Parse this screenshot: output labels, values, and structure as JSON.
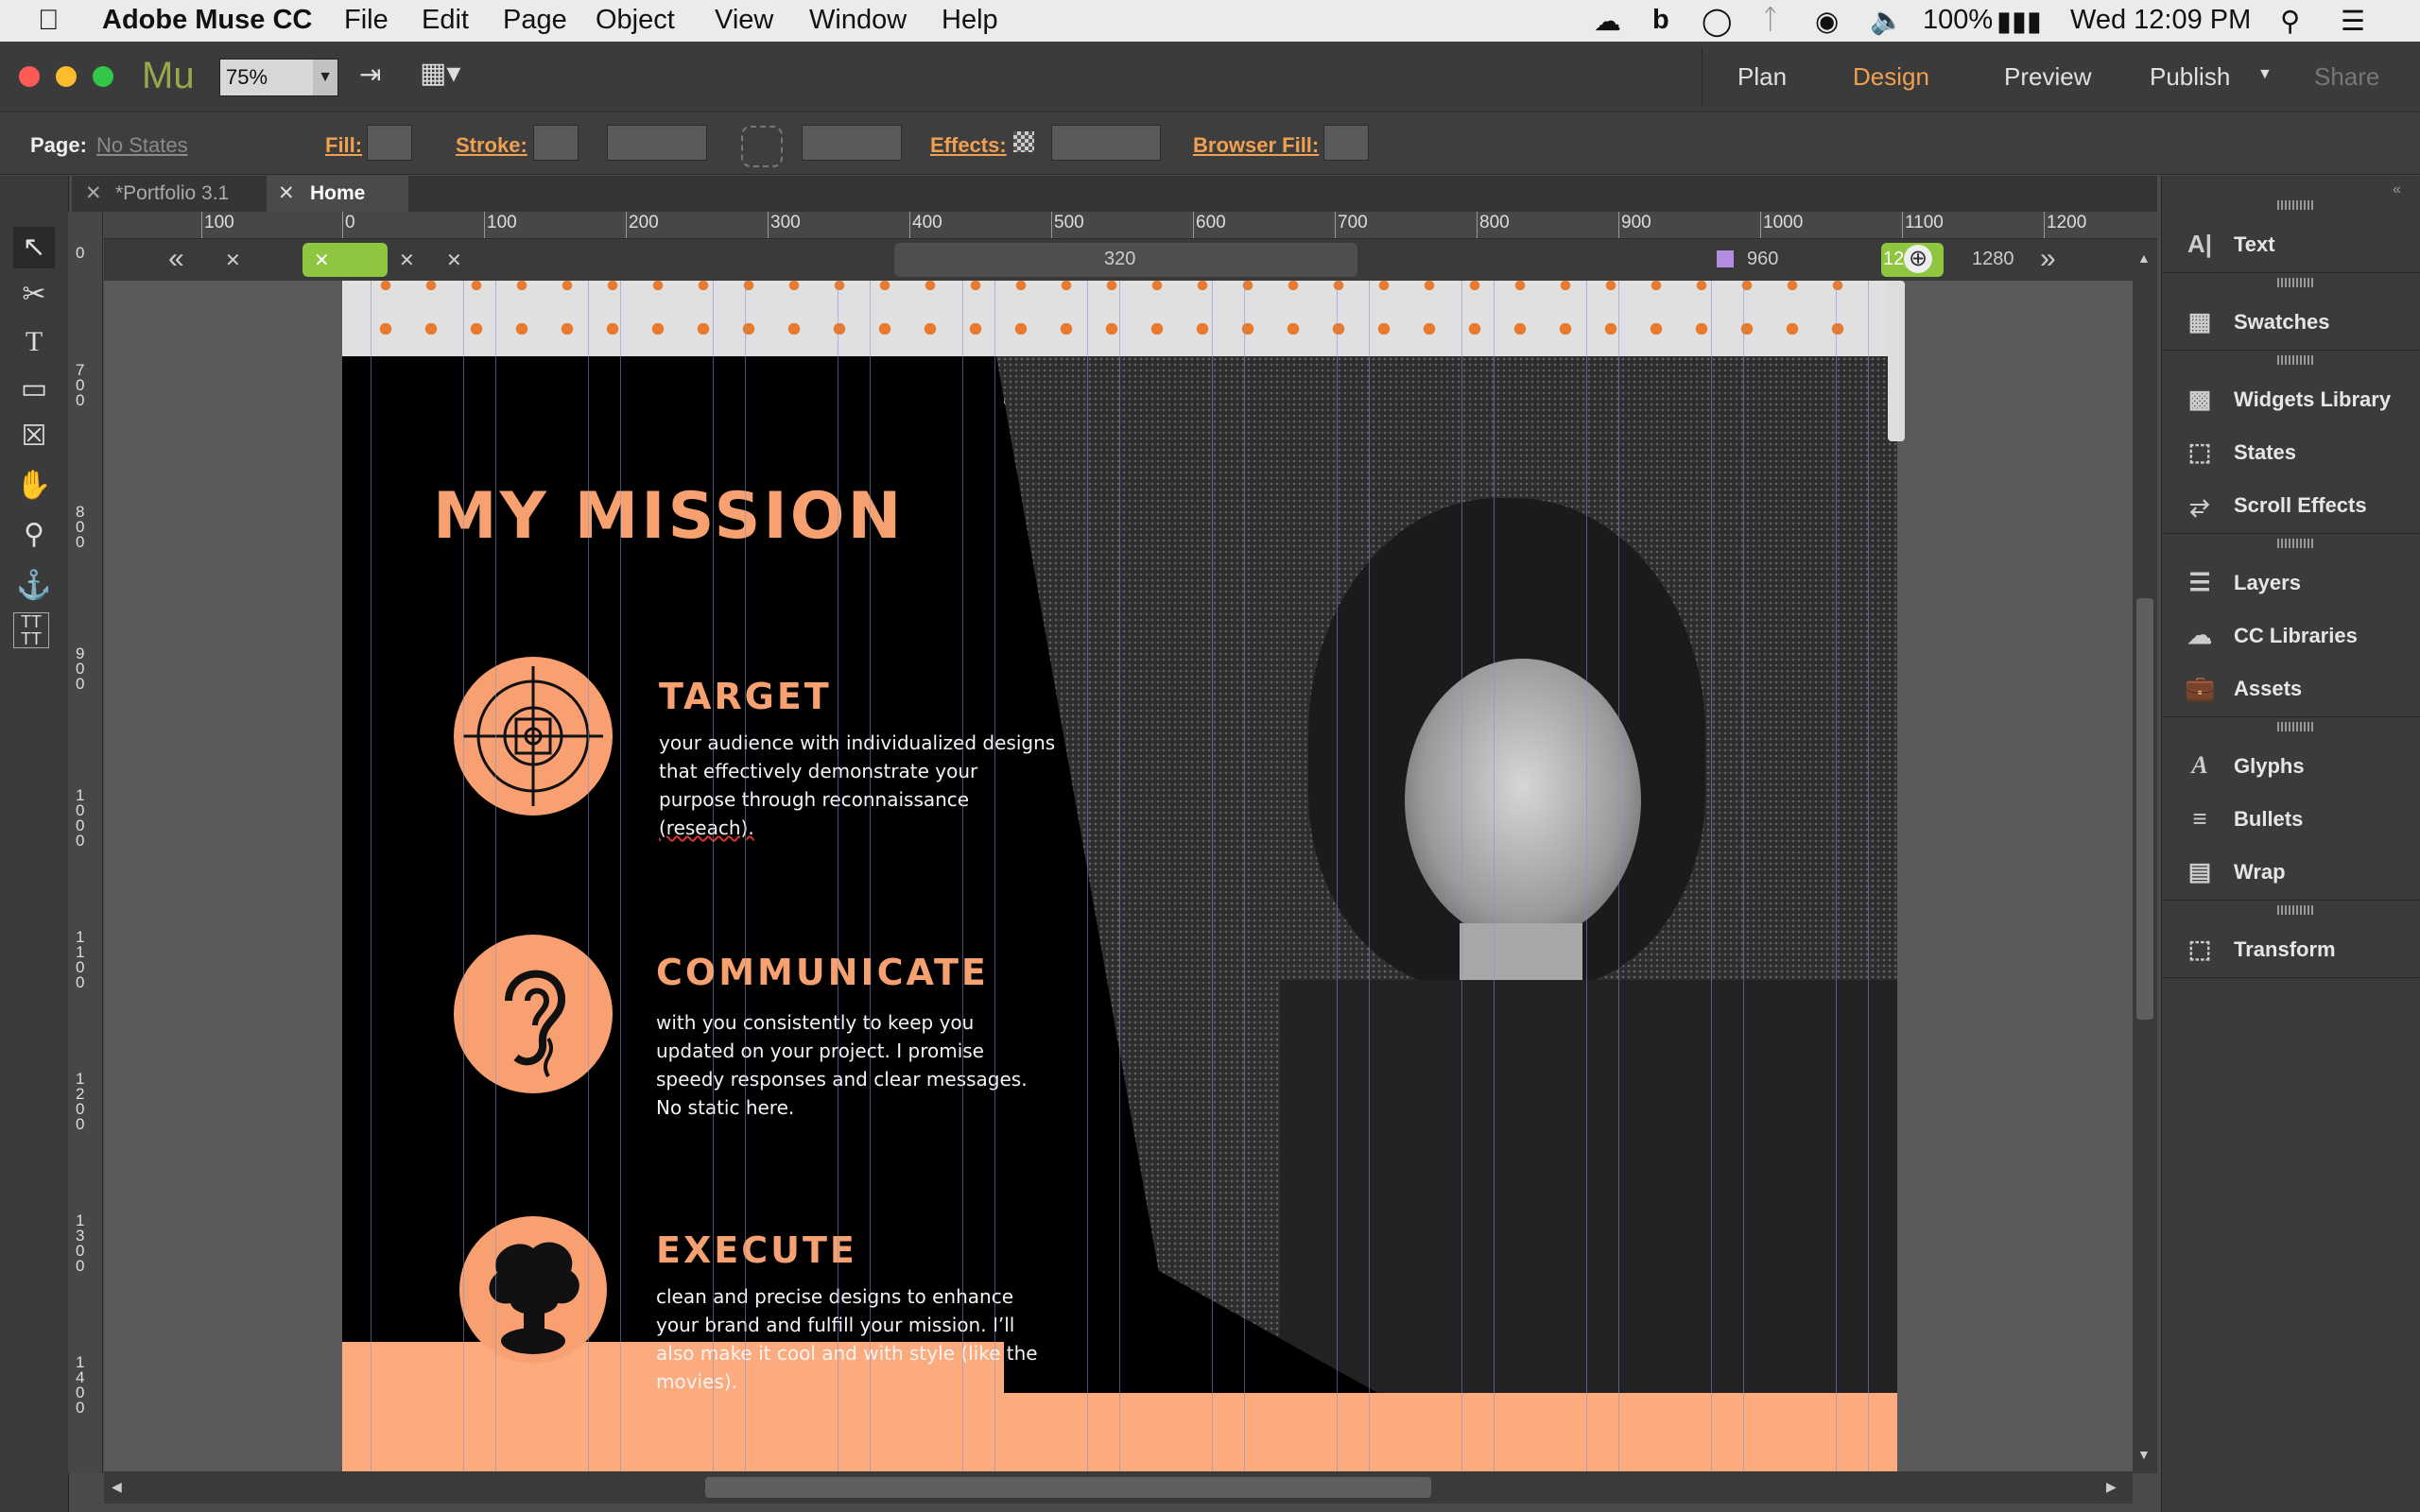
{
  "menubar": {
    "app_name": "Adobe Muse CC",
    "menus": [
      "File",
      "Edit",
      "Page",
      "Object",
      "View",
      "Window",
      "Help"
    ],
    "battery": "100%",
    "clock": "Wed 12:09 PM"
  },
  "appbar": {
    "logo": "Mu",
    "zoom": "75%",
    "modes": [
      "Plan",
      "Design",
      "Preview",
      "Publish",
      "Share"
    ],
    "active_mode": "Design"
  },
  "controlbar": {
    "page_label": "Page:",
    "page_value": "No States",
    "fill_label": "Fill:",
    "stroke_label": "Stroke:",
    "effects_label": "Effects:",
    "browser_fill_label": "Browser Fill:"
  },
  "tabs": [
    "*Portfolio 3.1",
    "Home"
  ],
  "active_tab": "Home",
  "ruler": {
    "h_labels": [
      "100",
      "0",
      "100",
      "200",
      "300",
      "400",
      "500",
      "600",
      "700",
      "800",
      "900",
      "1000",
      "1100",
      "1200"
    ],
    "v_labels": [
      "0",
      "700",
      "800",
      "900",
      "1000",
      "1100",
      "1200",
      "1300",
      "1400"
    ]
  },
  "breakpoints": {
    "label_320": "320",
    "label_960": "960",
    "label_12": "12",
    "label_1280": "1280"
  },
  "right_panel": [
    {
      "label": "Text",
      "icon": "text-icon"
    },
    {
      "label": "Swatches",
      "icon": "swatches-icon"
    },
    {
      "label": "Widgets Library",
      "icon": "widgets-icon"
    },
    {
      "label": "States",
      "icon": "states-icon"
    },
    {
      "label": "Scroll Effects",
      "icon": "scroll-effects-icon"
    },
    {
      "label": "Layers",
      "icon": "layers-icon"
    },
    {
      "label": "CC Libraries",
      "icon": "cc-libraries-icon"
    },
    {
      "label": "Assets",
      "icon": "assets-icon"
    },
    {
      "label": "Glyphs",
      "icon": "glyphs-icon"
    },
    {
      "label": "Bullets",
      "icon": "bullets-icon"
    },
    {
      "label": "Wrap",
      "icon": "wrap-icon"
    },
    {
      "label": "Transform",
      "icon": "transform-icon"
    }
  ],
  "page": {
    "title": "MY MISSION",
    "sections": [
      {
        "heading": "TARGET",
        "lines": [
          "your audience with individualized designs",
          "that effectively demonstrate your",
          "purpose through reconnaissance",
          "(reseach)."
        ]
      },
      {
        "heading": "COMMUNICATE",
        "lines": [
          "with you consistently to keep you",
          "updated on your project. I promise",
          "speedy responses and clear messages.",
          "No static here."
        ]
      },
      {
        "heading": "EXECUTE",
        "lines": [
          "clean and precise designs to enhance",
          "your brand and fulfill your mission. I’ll",
          "also make it cool and with style (like the",
          "movies)."
        ]
      }
    ]
  },
  "colors": {
    "accent": "#f7a070",
    "active_mode": "#f0a050",
    "panel_bg": "#3b3b3b"
  }
}
